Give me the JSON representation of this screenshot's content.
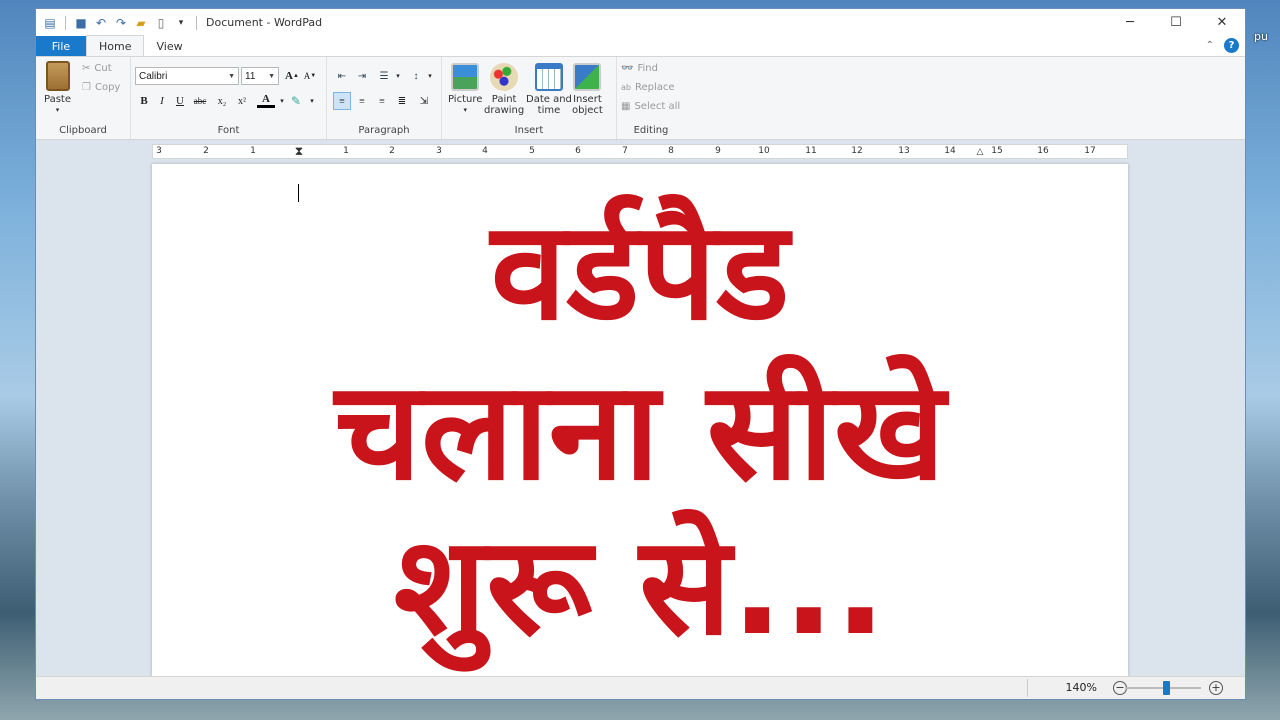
{
  "window": {
    "title": "Document - WordPad"
  },
  "tabs": [
    {
      "label": "File"
    },
    {
      "label": "Home"
    },
    {
      "label": "View"
    }
  ],
  "clipboard": {
    "paste": "Paste",
    "cut": "Cut",
    "copy": "Copy",
    "label": "Clipboard"
  },
  "font": {
    "family": "Calibri",
    "size": "11",
    "label": "Font"
  },
  "paragraph": {
    "label": "Paragraph"
  },
  "insert": {
    "picture": "Picture",
    "paint_line1": "Paint",
    "paint_line2": "drawing",
    "date_line1": "Date and",
    "date_line2": "time",
    "object_line1": "Insert",
    "object_line2": "object",
    "label": "Insert"
  },
  "editing": {
    "find": "Find",
    "replace": "Replace",
    "select_all": "Select all",
    "label": "Editing"
  },
  "ruler": {
    "numbers": [
      "3",
      "2",
      "1",
      "1",
      "2",
      "3",
      "4",
      "5",
      "6",
      "7",
      "8",
      "9",
      "10",
      "11",
      "12",
      "13",
      "14",
      "15",
      "16",
      "17"
    ]
  },
  "document": {
    "line1": "वर्डपैड",
    "line2": "चलाना सीखे",
    "line3": "शुरू से..."
  },
  "status": {
    "zoom": "140%",
    "zoom_level": 0.55
  },
  "desktop": {
    "edge_text": "pu"
  },
  "colors": {
    "accent": "#1979ca",
    "doc_text": "#c8141a"
  }
}
